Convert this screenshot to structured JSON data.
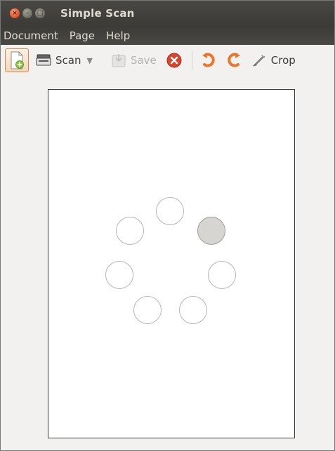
{
  "window": {
    "title": "Simple Scan"
  },
  "menu": {
    "items": [
      "Document",
      "Page",
      "Help"
    ]
  },
  "toolbar": {
    "scan_label": "Scan",
    "save_label": "Save",
    "crop_label": "Crop"
  },
  "colors": {
    "titlebar": "#3c3b37",
    "close_button": "#e45a2c",
    "stop_button": "#d9442c",
    "rotate_arrows": "#e8772b"
  },
  "icons": [
    "new-document-icon",
    "scanner-icon",
    "save-icon",
    "stop-icon",
    "rotate-left-icon",
    "rotate-right-icon",
    "crop-icon"
  ]
}
